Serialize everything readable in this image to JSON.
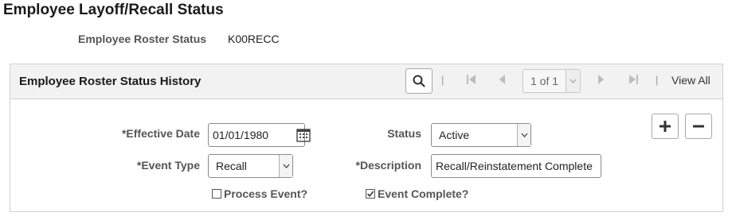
{
  "page": {
    "title": "Employee Layoff/Recall Status",
    "roster_status_label": "Employee Roster Status",
    "roster_status_value": "K00RECC"
  },
  "panel": {
    "title": "Employee Roster Status History",
    "separator": "|",
    "pagination": {
      "page_value": "1 of 1",
      "view_all_label": "View All"
    }
  },
  "form": {
    "effective_date_label": "*Effective Date",
    "effective_date_value": "01/01/1980",
    "status_label": "Status",
    "status_value": "Active",
    "event_type_label": "*Event Type",
    "event_type_value": "Recall",
    "description_label": "*Description",
    "description_value": "Recall/Reinstatement Complete",
    "process_event_label": "Process Event?",
    "process_event_checked": false,
    "event_complete_label": "Event Complete?",
    "event_complete_checked": true
  },
  "icons": {
    "search": "search-icon",
    "first": "first-page-icon",
    "prev": "previous-page-icon",
    "next": "next-page-icon",
    "last": "last-page-icon",
    "calendar": "calendar-icon",
    "add": "plus-icon",
    "remove": "minus-icon",
    "dropdown": "chevron-down-icon"
  },
  "colors": {
    "text": "#333333",
    "label": "#555555",
    "header_bg": "#f2f2f2",
    "border": "#d0d0d0",
    "disabled_icon": "#bdbdbd"
  }
}
